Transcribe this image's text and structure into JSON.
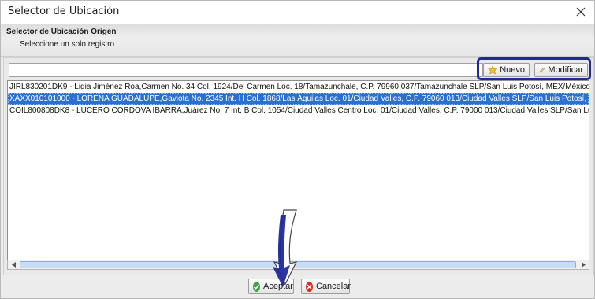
{
  "window": {
    "title": "Selector de Ubicación"
  },
  "header": {
    "title": "Selector de Ubicación Origen",
    "subtitle": "Seleccione un solo registro"
  },
  "search": {
    "value": "",
    "placeholder": ""
  },
  "toolbar": {
    "new_label": "Nuevo",
    "edit_label": "Modificar"
  },
  "list": {
    "items": [
      {
        "text": "JIRL830201DK9 - Lidia Jiménez Roa,Carmen No. 34 Col. 1924/Del Carmen Loc. 18/Tamazunchale, C.P. 79960 037/Tamazunchale SLP/San Luis Potosí, MEX/México",
        "selected": false
      },
      {
        "text": "XAXX010101000 - LORENA GUADALUPE,Gaviota No. 2345 Int. H Col. 1868/Las Águilas Loc. 01/Ciudad Valles, C.P. 79060 013/Ciudad Valles SLP/San Luis Potosí, MEX/México",
        "selected": true
      },
      {
        "text": "COIL800808DK8 - LUCERO CORDOVA IBARRA,Juárez No. 7 Int. B Col. 1054/Ciudad Valles Centro Loc. 01/Ciudad Valles, C.P. 79000 013/Ciudad Valles SLP/San Luis Potosí, MEX/",
        "selected": false
      }
    ]
  },
  "footer": {
    "accept_label": "Aceptar",
    "cancel_label": "Cancelar"
  },
  "colors": {
    "selection": "#2b6fcf",
    "annotation": "#1f2a9a",
    "accept_icon": "#3aa346",
    "cancel_icon": "#d62b2b"
  },
  "icons": {
    "close": "close-icon",
    "new": "star-icon",
    "edit": "pencil-icon",
    "accept": "check-circle-icon",
    "cancel": "x-circle-icon"
  }
}
